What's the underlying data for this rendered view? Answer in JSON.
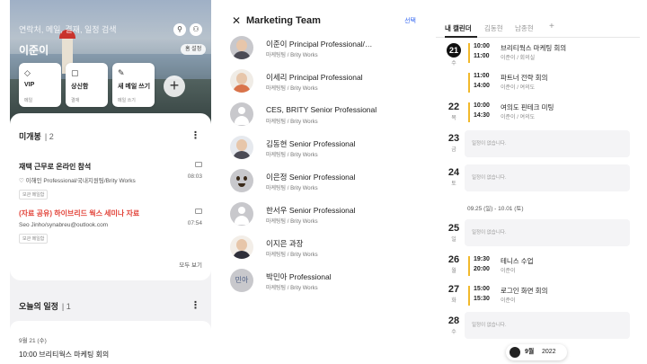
{
  "panel_home": {
    "search_placeholder": "연락처, 메일, 결재, 일정 검색",
    "user_name": "이준이",
    "settings_chip": "홈 설정",
    "quick_cards": [
      {
        "label": "VIP",
        "sub": "메일",
        "icon": "gem-icon",
        "glyph": "◇"
      },
      {
        "label": "상신함",
        "sub": "결재",
        "icon": "doc-icon",
        "glyph": "▢"
      },
      {
        "label": "새 메일 쓰기",
        "sub": "메일 쓰기",
        "icon": "pen-icon",
        "glyph": "✎"
      }
    ],
    "add_glyph": "+",
    "unread": {
      "title": "미개봉",
      "count": "2",
      "mails": [
        {
          "subject": "재택 근무로 온라인 참석",
          "from": "이해인 Professional/국내지원팀/Brity Works",
          "time": "08:03",
          "tag": "보관 메일함",
          "highlight": false
        },
        {
          "subject": "(자료 공유) 하이브리드 웍스 세미나 자료",
          "from": "Seo Jinho/synabreu@outlook.com",
          "time": "07:54",
          "tag": "보관 메일함",
          "highlight": true
        }
      ],
      "see_all": "모두 보기"
    },
    "today": {
      "title": "오늘의 일정",
      "count": "1",
      "date": "9월 21 (수)",
      "cut_text": "10:00   브리티웍스 마케팅 회의"
    }
  },
  "panel_team": {
    "close_glyph": "✕",
    "title": "Marketing Team",
    "select_label": "선택",
    "members": [
      {
        "name": "이준이 Principal Professional/…",
        "dept": "마케팅팀 / Brity Works",
        "avatar": "photo-male-1",
        "avatar_text": ""
      },
      {
        "name": "이세리 Principal Professional",
        "dept": "마케팅팀 / Brity Works",
        "avatar": "photo-female-1",
        "avatar_text": ""
      },
      {
        "name": "CES, BRITY Senior Professional",
        "dept": "마케팅팀 / Brity Works",
        "avatar": "default",
        "avatar_text": ""
      },
      {
        "name": "김동현 Senior Professional",
        "dept": "마케팅팀 / Brity Works",
        "avatar": "photo-male-2",
        "avatar_text": ""
      },
      {
        "name": "이은정 Senior Professional",
        "dept": "마케팅팀 / Brity Works",
        "avatar": "emoji",
        "avatar_text": ""
      },
      {
        "name": "한서우 Senior Professional",
        "dept": "마케팅팀 / Brity Works",
        "avatar": "default",
        "avatar_text": ""
      },
      {
        "name": "이지은 과장",
        "dept": "마케팅팀 / Brity Works",
        "avatar": "photo-female-2",
        "avatar_text": ""
      },
      {
        "name": "박민아 Professional",
        "dept": "마케팅팀 / Brity Works",
        "avatar": "initials",
        "avatar_text": "민아"
      }
    ]
  },
  "panel_calendar": {
    "tabs": [
      "내 캘린더",
      "김동현",
      "남종현"
    ],
    "tab_add": "+",
    "days": [
      {
        "num": "21",
        "dow": "수",
        "today": true
      },
      {
        "num": "22",
        "dow": "목",
        "today": false
      },
      {
        "num": "23",
        "dow": "금",
        "today": false
      },
      {
        "num": "24",
        "dow": "토",
        "today": false
      },
      {
        "num": "25",
        "dow": "일",
        "today": false
      },
      {
        "num": "26",
        "dow": "월",
        "today": false
      },
      {
        "num": "27",
        "dow": "화",
        "today": false
      },
      {
        "num": "28",
        "dow": "수",
        "today": false
      }
    ],
    "events": [
      {
        "start": "10:00",
        "end": "11:00",
        "title": "브리티웍스 마케팅 회의",
        "location": "이준이 / 회의실"
      },
      {
        "start": "11:00",
        "end": "14:00",
        "title": "파트너 전략 회의",
        "location": "이준이 / 여의도"
      },
      {
        "start": "10:00",
        "end": "14:30",
        "title": "여의도 핀테크 미팅",
        "location": "이준이 / 여의도"
      },
      {
        "start": "19:30",
        "end": "20:00",
        "title": "테니스 수업",
        "location": "이준이"
      },
      {
        "start": "15:00",
        "end": "15:30",
        "title": "로그인 화면 회의",
        "location": "이준이"
      }
    ],
    "empty_text": "일정이 없습니다.",
    "week_range": "09.25 (일) - 10.01 (토)",
    "month_pill": {
      "month": "9월",
      "year": "2022"
    },
    "event_color": "#f2b92b"
  }
}
